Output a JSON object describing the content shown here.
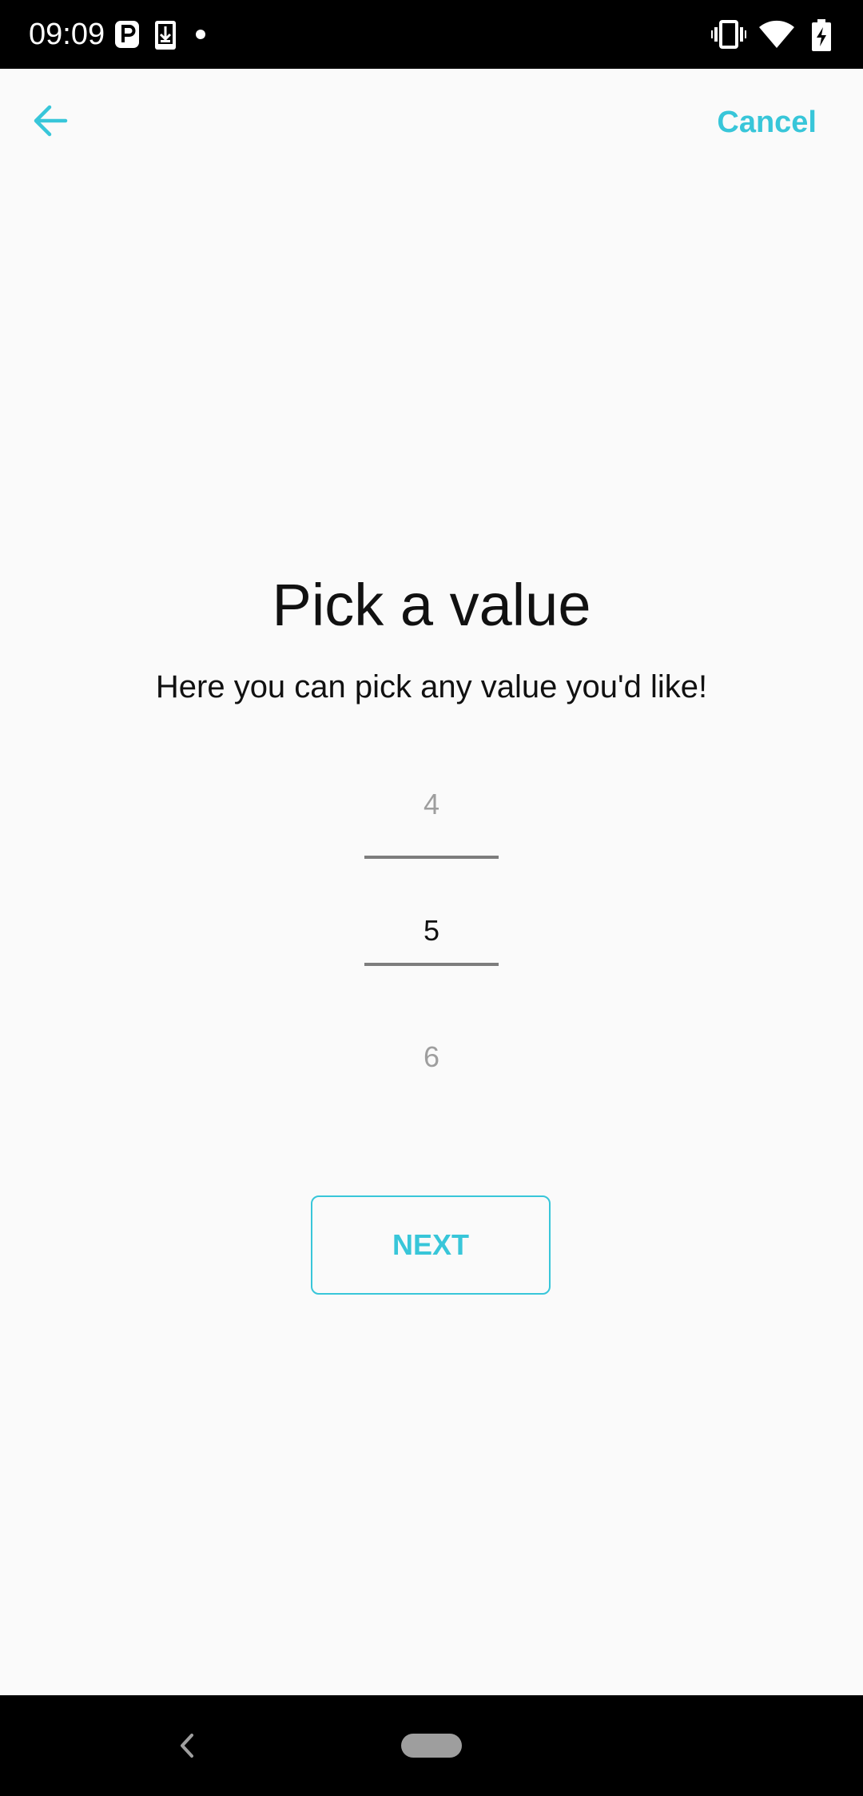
{
  "status_bar": {
    "time": "09:09",
    "icons": [
      "parking-icon",
      "download-icon",
      "dot-icon",
      "vibrate-icon",
      "wifi-icon",
      "battery-charging-icon"
    ]
  },
  "toolbar": {
    "back_icon": "arrow-left-icon",
    "cancel_label": "Cancel"
  },
  "content": {
    "title": "Pick a value",
    "subtitle": "Here you can pick any value you'd like!",
    "picker": {
      "previous": "4",
      "selected": "5",
      "next": "6"
    },
    "next_label": "NEXT"
  },
  "nav_bar": {
    "back_icon": "nav-back-icon",
    "home_icon": "nav-home-pill-icon"
  },
  "colors": {
    "accent": "#38c6d9",
    "background": "#fafafa",
    "text": "#111111",
    "muted": "#9e9e9e"
  }
}
